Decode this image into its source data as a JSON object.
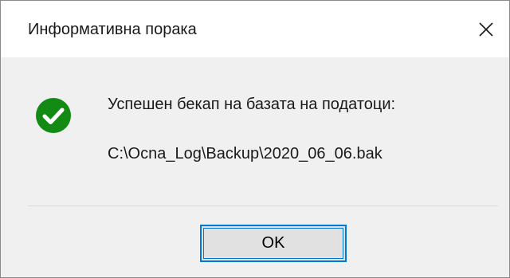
{
  "dialog": {
    "title": "Информативна порака",
    "close_icon": "close-icon",
    "status_icon": "success-check-icon",
    "status_color": "#138a13",
    "message": "Успешен бекап на базата на податоци:",
    "path": "C:\\Ocna_Log\\Backup\\2020_06_06.bak",
    "ok_label": "OK",
    "accent_color": "#0078d7"
  }
}
